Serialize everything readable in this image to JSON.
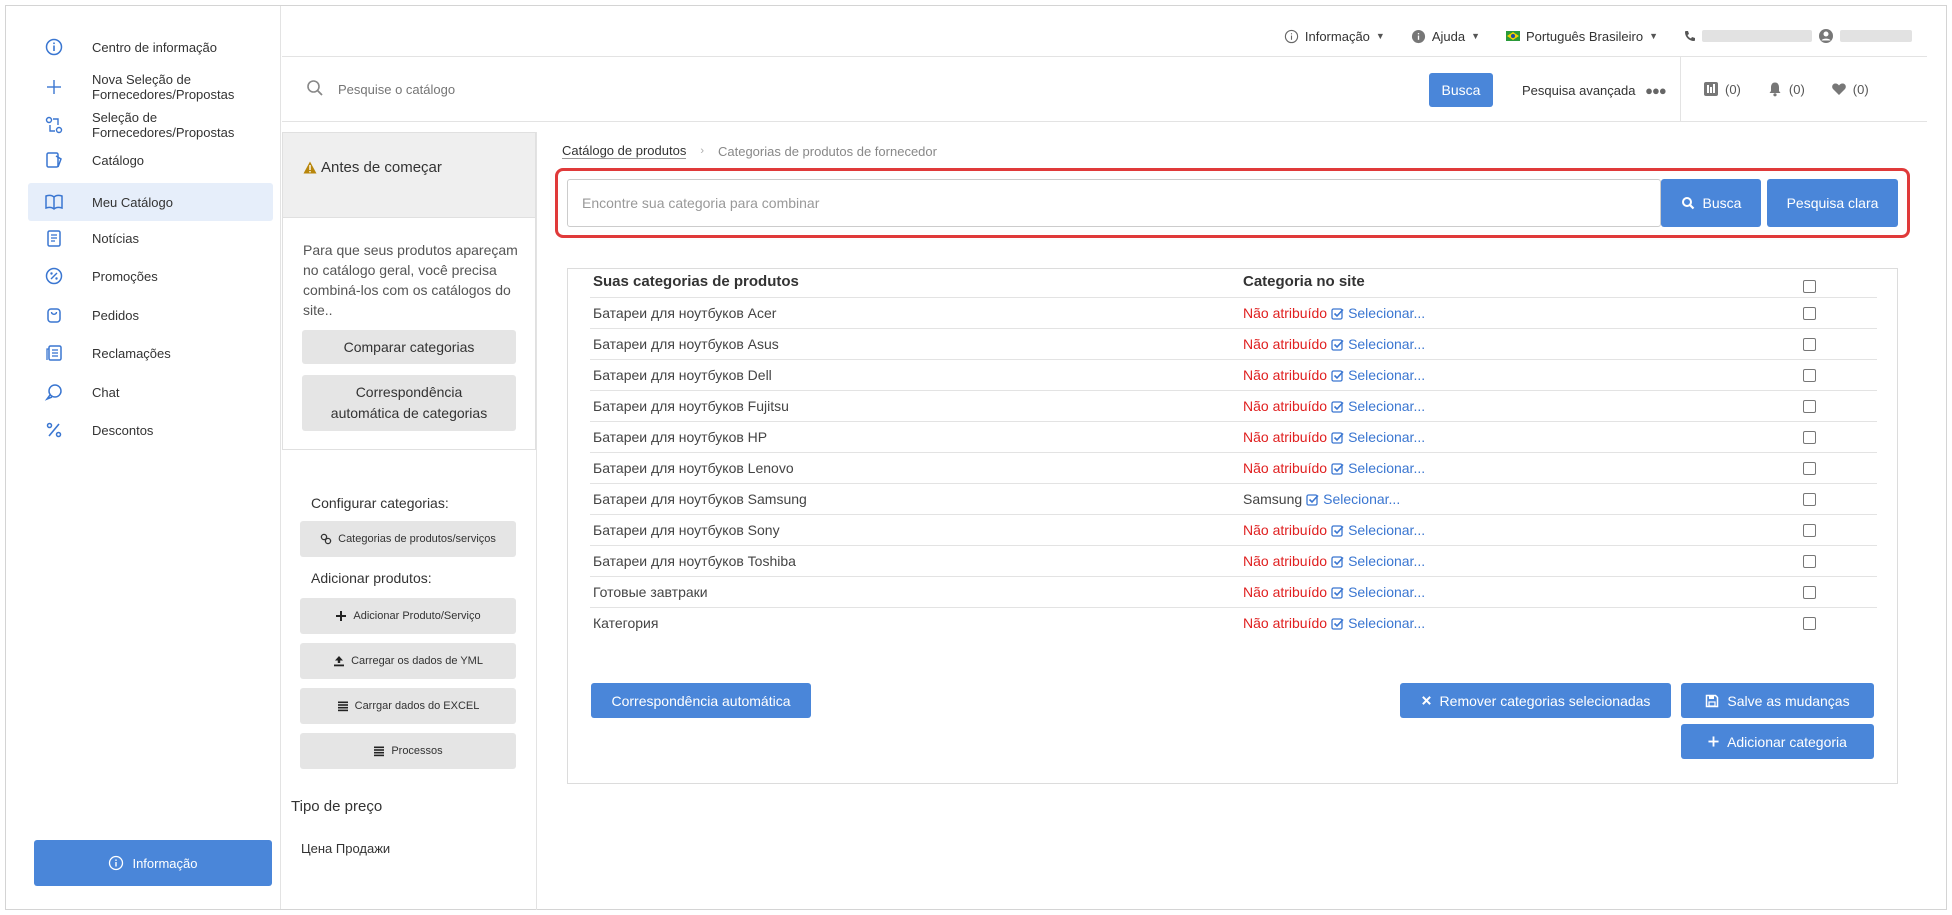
{
  "sidebar": {
    "items": [
      {
        "label": "Centro de informação",
        "icon": "info-circle-icon"
      },
      {
        "label": "Nova Seleção de Fornecedores/Propostas",
        "icon": "plus-icon"
      },
      {
        "label": "Seleção de Fornecedores/Propostas",
        "icon": "exchange-icon"
      },
      {
        "label": "Catálogo",
        "icon": "catalog-icon"
      },
      {
        "label": "Meu Catálogo",
        "icon": "book-icon"
      },
      {
        "label": "Notícias",
        "icon": "news-icon"
      },
      {
        "label": "Promoções",
        "icon": "percent-badge-icon"
      },
      {
        "label": "Pedidos",
        "icon": "bag-icon"
      },
      {
        "label": "Reclamações",
        "icon": "complaints-icon"
      },
      {
        "label": "Chat",
        "icon": "chat-icon"
      },
      {
        "label": "Descontos",
        "icon": "percent-icon"
      }
    ],
    "info_button": "Informação"
  },
  "topbar": {
    "info": "Informação",
    "help": "Ajuda",
    "language": "Português Brasileiro"
  },
  "search": {
    "placeholder": "Pesquise o catálogo",
    "button": "Busca",
    "advanced": "Pesquisa avançada",
    "compare_count": "(0)",
    "notifications_count": "(0)",
    "favorites_count": "(0)"
  },
  "midpanel": {
    "warning_title": "Antes de começar",
    "info_text": "Para que seus produtos apareçam no catálogo geral, você precisa combiná-los com os catálogos do site..",
    "compare_btn": "Comparar categorias",
    "auto_match_btn": "Correspondência automática de categorias",
    "configure_label": "Configurar categorias:",
    "categories_btn": "Categorias de produtos/serviços",
    "add_products_label": "Adicionar produtos:",
    "add_product_btn": "Adicionar Produto/Serviço",
    "load_yml_btn": "Carregar os dados de YML",
    "load_excel_btn": "Carrgar dados do EXCEL",
    "processes_btn": "Processos",
    "price_type_label": "Tipo de preço",
    "price_type_value": "Цена Продажи"
  },
  "breadcrumb": {
    "root": "Catálogo de produtos",
    "current": "Categorias de produtos de fornecedor"
  },
  "category_search": {
    "placeholder": "Encontre sua categoria para combinar",
    "search_btn": "Busca",
    "clear_btn": "Pesquisa clara"
  },
  "table": {
    "col_your": "Suas categorias de produtos",
    "col_site": "Categoria no site",
    "select_label": "Selecionar...",
    "rows": [
      {
        "name": "Батареи для ноутбуков Acer",
        "status": "Não atribuído",
        "assigned": false
      },
      {
        "name": "Батареи для ноутбуков Asus",
        "status": "Não atribuído",
        "assigned": false
      },
      {
        "name": "Батареи для ноутбуков Dell",
        "status": "Não atribuído",
        "assigned": false
      },
      {
        "name": "Батареи для ноутбуков Fujitsu",
        "status": "Não atribuído",
        "assigned": false
      },
      {
        "name": "Батареи для ноутбуков HP",
        "status": "Não atribuído",
        "assigned": false
      },
      {
        "name": "Батареи для ноутбуков Lenovo",
        "status": "Não atribuído",
        "assigned": false
      },
      {
        "name": "Батареи для ноутбуков Samsung",
        "status": "Samsung",
        "assigned": true
      },
      {
        "name": "Батареи для ноутбуков Sony",
        "status": "Não atribuído",
        "assigned": false
      },
      {
        "name": "Батареи для ноутбуков Toshiba",
        "status": "Não atribuído",
        "assigned": false
      },
      {
        "name": "Готовые завтраки",
        "status": "Não atribuído",
        "assigned": false
      },
      {
        "name": "Категория",
        "status": "Não atribuído",
        "assigned": false
      }
    ]
  },
  "actions": {
    "auto_match": "Correspondência automática",
    "remove_selected": "Remover categorias selecionadas",
    "save_changes": "Salve as mudanças",
    "add_category": "Adicionar categoria"
  }
}
